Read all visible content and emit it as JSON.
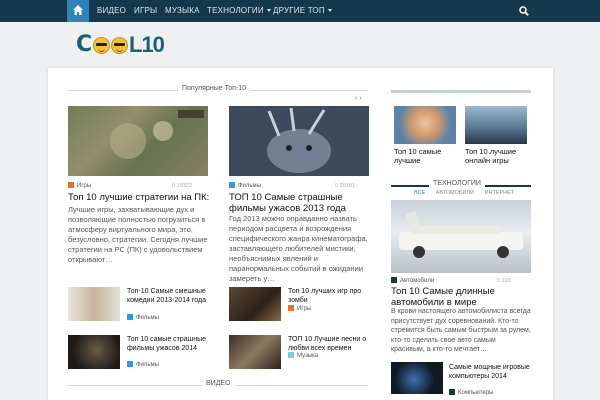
{
  "nav": {
    "items": [
      {
        "label": "ВИДЕО"
      },
      {
        "label": "ИГРЫ"
      },
      {
        "label": "МУЗЫКА"
      },
      {
        "label": "ТЕХНОЛОГИИ"
      },
      {
        "label": "ДРУГИЕ ТОП"
      }
    ]
  },
  "sections": {
    "popular": "Популярные Топ-10",
    "tech": "ТЕХНОЛОГИИ",
    "video": "ВИДЕО"
  },
  "slider_arrows": "‹ ›",
  "featured": [
    {
      "category": "Игры",
      "category_color": "#e8702a",
      "title": "Топ 10 лучшие стратегии на ПК:",
      "excerpt": "Лучшие игры, захватывающие дух и позволяющие полностью погрузиться в атмосферу виртуального мира, это, безусловно, стратегии. Сегодня лучшие стратегии на PC (ПК) с удовольствием открывают…",
      "meta": "0   19322"
    },
    {
      "category": "Фильмы",
      "category_color": "#2e9bd6",
      "title": "ТОП 10 Самые страшные фильмы ужасов 2013 года",
      "excerpt": "Год 2013 можно оправданно назвать периодом расцвета и возрождения специфического жанра кинематографа, заставляющего любителей мистики, необъяснимых явлений и паранормальных событий в ожидании замереть у…",
      "meta": "0   20181"
    }
  ],
  "small_posts": [
    {
      "title": "Топ-10 Самые смешные комедии 2013-2014 года",
      "category": "Фильмы",
      "category_color": "#2e9bd6"
    },
    {
      "title": "Топ 10 лучших игр про зомби",
      "category": "Игры",
      "category_color": "#e8702a"
    },
    {
      "title": "Топ 10 самые страшные фильмы ужасов 2014",
      "category": "Фильмы",
      "category_color": "#2e9bd6"
    },
    {
      "title": "ТОП 10 Лучшие песни о любви всех времен",
      "category": "Музыка",
      "category_color": "#7fc6e8"
    }
  ],
  "sidebar_top": [
    {
      "title": "Топ 10 самые лучшие"
    },
    {
      "title": "Топ 10 лучшие онлайн игры"
    }
  ],
  "tech_tabs": [
    "ВСЕ",
    "АВТОМОБИЛИ",
    "ИНТЕРНЕТ"
  ],
  "tech_featured": {
    "category": "Автомобили",
    "category_color": "#16384d",
    "title": "Топ 10 Самые длинные автомобили в мире",
    "excerpt": "В крови настоящего автомобилиста всегда присутствует дух соревнований. Кто-то стремится быть самым быстрым за рулем, кто-то сделать свое авто самым красивым, а кто-то мечтает…",
    "meta": "0   103"
  },
  "tech_small": {
    "title": "Самые мощные игровые компьютеры 2014",
    "category": "Компьютеры",
    "category_color": "#16384d"
  },
  "colors": {
    "nav_bg": "#16384d",
    "accent": "#2e83b9",
    "logo": "#1b5e75"
  }
}
